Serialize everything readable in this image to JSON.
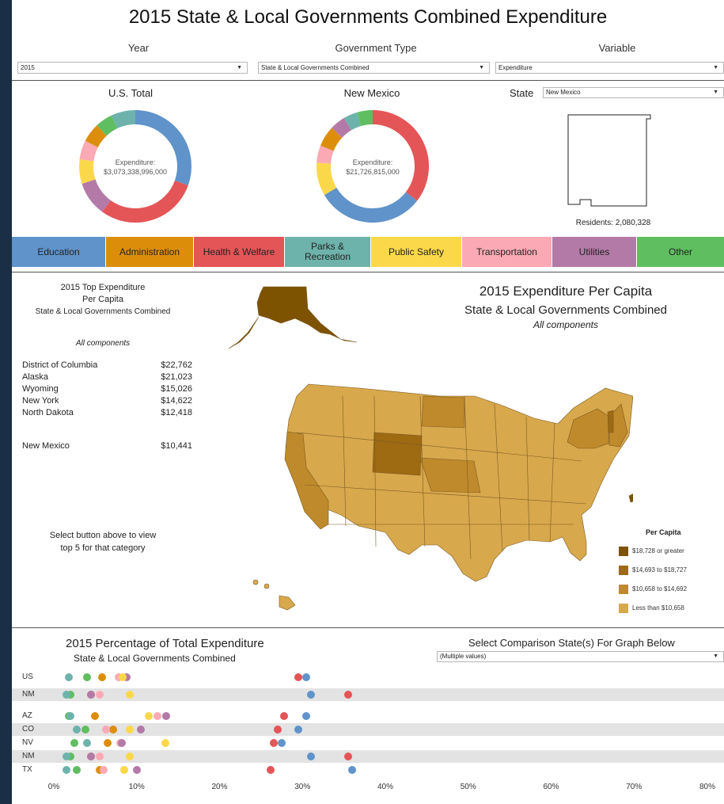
{
  "title": "2015 State & Local Governments Combined Expenditure",
  "filters": {
    "year": {
      "label": "Year",
      "value": "2015"
    },
    "gov_type": {
      "label": "Government Type",
      "value": "State & Local Governments Combined"
    },
    "variable": {
      "label": "Variable",
      "value": "Expenditure"
    }
  },
  "us_total": {
    "title": "U.S. Total",
    "center_label": "Expenditure:",
    "center_value": "$3,073,338,996,000",
    "shares": [
      0.305,
      0.295,
      0.1,
      0.07,
      0.055,
      0.055,
      0.05,
      0.07
    ]
  },
  "state_panel": {
    "title": "New Mexico",
    "center_label": "Expenditure:",
    "center_value": "$21,726,815,000",
    "shares": [
      0.355,
      0.31,
      0.095,
      0.05,
      0.06,
      0.045,
      0.04,
      0.045
    ]
  },
  "state_selector": {
    "label": "State",
    "value": "New Mexico"
  },
  "residents": "Residents: 2,080,328",
  "categories": [
    {
      "label": "Education",
      "color": "#5f93c9"
    },
    {
      "label": "Administration",
      "color": "#dc8e0b"
    },
    {
      "label": "Health & Welfare",
      "color": "#e45557"
    },
    {
      "label": "Parks & Recreation",
      "color": "#6db3ab"
    },
    {
      "label": "Public Safety",
      "color": "#fbd84a"
    },
    {
      "label": "Transportation",
      "color": "#fba9b4"
    },
    {
      "label": "Utilities",
      "color": "#b47aa7"
    },
    {
      "label": "Other",
      "color": "#5fbe60"
    }
  ],
  "top_list": {
    "title1": "2015 Top Expenditure",
    "title2": "Per Capita",
    "title3": "State & Local Governments Combined",
    "subtitle": "All components",
    "rows": [
      {
        "name": "District of Columbia",
        "value": "$22,762"
      },
      {
        "name": "Alaska",
        "value": "$21,023"
      },
      {
        "name": "Wyoming",
        "value": "$15,026"
      },
      {
        "name": "New York",
        "value": "$14,622"
      },
      {
        "name": "North Dakota",
        "value": "$12,418"
      }
    ],
    "selected": {
      "name": "New Mexico",
      "value": "$10,441"
    },
    "hint1": "Select button above to view",
    "hint2": "top 5 for that category"
  },
  "map": {
    "title1": "2015 Expenditure Per Capita",
    "title2": "State & Local Governments Combined",
    "subtitle": "All components",
    "legend_title": "Per Capita",
    "legend": [
      {
        "label": "$18,728 or greater",
        "color": "#7d5200"
      },
      {
        "label": "$14,693 to $18,727",
        "color": "#9e6a12"
      },
      {
        "label": "$10,658 to $14,692",
        "color": "#bf8a2b"
      },
      {
        "label": "Less than $10,658",
        "color": "#d8a84c"
      }
    ]
  },
  "comparison": {
    "title1": "2015 Percentage of Total Expenditure",
    "title2": "State & Local Governments Combined",
    "select_label": "Select Comparison State(s) For Graph Below",
    "select_value": "(Multiple values)"
  },
  "chart_data": {
    "type": "scatter",
    "x_ticks": [
      "0%",
      "10%",
      "20%",
      "30%",
      "40%",
      "50%",
      "60%",
      "70%",
      "80%"
    ],
    "xlim": [
      0,
      80
    ],
    "series_order": [
      "Other",
      "Parks & Recreation",
      "Administration",
      "Transportation",
      "Utilities",
      "Public Safety",
      "Health & Welfare",
      "Education"
    ],
    "rows": [
      {
        "label": "US",
        "values": [
          4.0,
          1.8,
          5.8,
          7.8,
          8.8,
          8.3,
          29.5,
          30.5
        ]
      },
      {
        "label": "NM",
        "values": [
          2.0,
          1.5,
          4.5,
          5.5,
          4.5,
          9.2,
          35.5,
          31.0
        ]
      },
      {
        "label": "AZ",
        "values": [
          1.8,
          2.0,
          5.0,
          12.5,
          13.6,
          11.5,
          27.8,
          30.5
        ]
      },
      {
        "label": "CO",
        "values": [
          3.8,
          2.8,
          7.2,
          6.3,
          10.5,
          9.2,
          27.0,
          29.5
        ]
      },
      {
        "label": "NV",
        "values": [
          2.5,
          4.0,
          6.5,
          8.0,
          8.2,
          13.5,
          26.5,
          27.5
        ]
      },
      {
        "label": "NM",
        "values": [
          2.0,
          1.5,
          4.5,
          5.5,
          4.5,
          9.2,
          35.5,
          31.0
        ]
      },
      {
        "label": "TX",
        "values": [
          2.8,
          1.5,
          5.5,
          6.0,
          10.0,
          8.5,
          26.2,
          36.0
        ]
      }
    ]
  }
}
